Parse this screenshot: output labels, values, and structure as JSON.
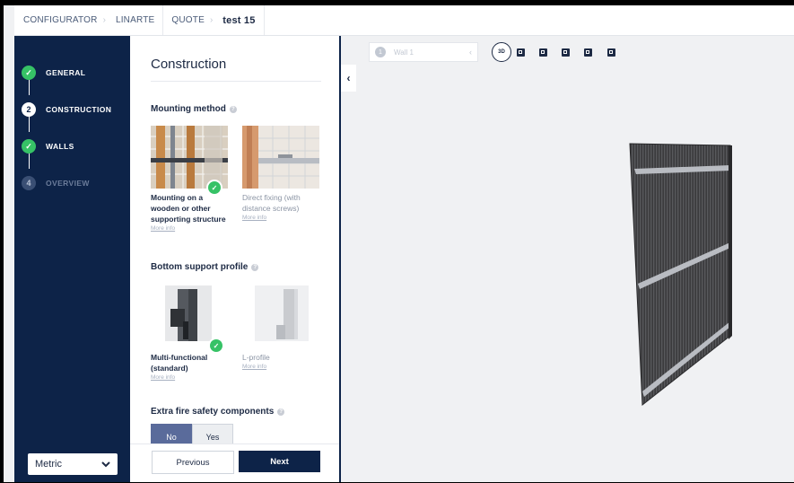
{
  "breadcrumb": {
    "items": [
      "CONFIGURATOR",
      "LINARTE",
      "QUOTE"
    ],
    "current": "test 15"
  },
  "steps": [
    {
      "number": "1",
      "label": "GENERAL",
      "state": "done"
    },
    {
      "number": "2",
      "label": "CONSTRUCTION",
      "state": "current"
    },
    {
      "number": "3",
      "label": "WALLS",
      "state": "done"
    },
    {
      "number": "4",
      "label": "OVERVIEW",
      "state": "future"
    }
  ],
  "unit_select": {
    "value": "Metric"
  },
  "panel": {
    "title": "Construction",
    "mounting": {
      "title": "Mounting method",
      "options": [
        {
          "name": "Mounting on a wooden or other supporting structure",
          "more": "More info",
          "selected": true
        },
        {
          "name": "Direct fixing (with distance screws)",
          "more": "More info",
          "selected": false
        }
      ]
    },
    "bottom_profile": {
      "title": "Bottom support profile",
      "options": [
        {
          "name": "Multi-functional (standard)",
          "more": "More info",
          "selected": true
        },
        {
          "name": "L-profile",
          "more": "More info",
          "selected": false
        }
      ]
    },
    "fire": {
      "title": "Extra fire safety components",
      "no": "No",
      "yes": "Yes",
      "value": "No"
    },
    "footer": {
      "previous": "Previous",
      "next": "Next"
    }
  },
  "viewport": {
    "wall_select": {
      "number": "1",
      "label": "Wall 1"
    },
    "view_buttons": [
      "3d-view-icon",
      "front-view-icon",
      "left-view-icon",
      "top-view-icon",
      "right-view-icon",
      "back-view-icon"
    ],
    "view_3d_label": "3D"
  },
  "colors": {
    "nav_bg": "#0d2348",
    "check_green": "#36c266",
    "toggle_on": "#5a6b9b"
  }
}
